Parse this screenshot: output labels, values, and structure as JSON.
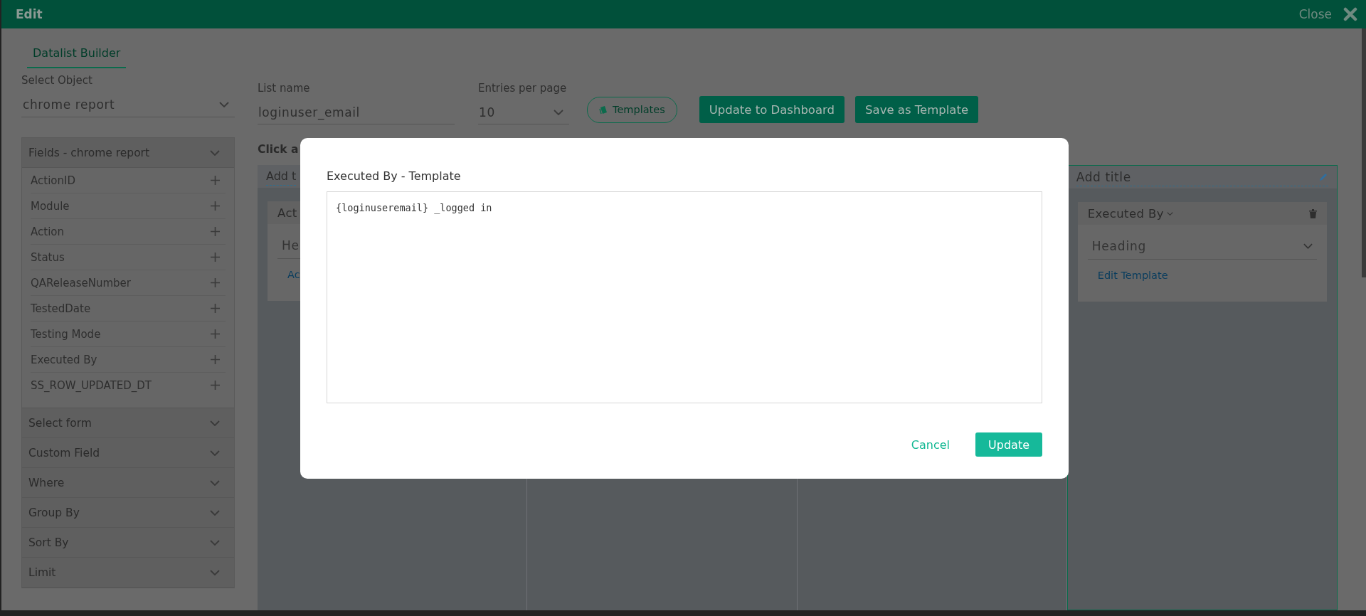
{
  "window": {
    "title": "Edit",
    "close_label": "Close"
  },
  "tabs": [
    {
      "label": "Datalist Builder",
      "selected": true
    }
  ],
  "select_object": {
    "label": "Select Object",
    "value": "chrome report"
  },
  "list_name": {
    "label": "List name",
    "value": "loginuser_email"
  },
  "entries_per_page": {
    "label": "Entries per page",
    "value": "10"
  },
  "toolbar_buttons": [
    {
      "label": "Templates",
      "kind": "outline"
    },
    {
      "label": "Update to Dashboard",
      "kind": "solid"
    },
    {
      "label": "Save as Template",
      "kind": "solid"
    }
  ],
  "sidebar": {
    "sections": [
      {
        "title": "Fields - chrome report",
        "items": [
          "ActionID",
          "Module",
          "Action",
          "Status",
          "QAReleaseNumber",
          "TestedDate",
          "Testing Mode",
          "Executed By",
          "SS_ROW_UPDATED_DT"
        ]
      },
      {
        "title": "Select form"
      },
      {
        "title": "Custom Field"
      },
      {
        "title": "Where"
      },
      {
        "title": "Group By"
      },
      {
        "title": "Sort By"
      },
      {
        "title": "Limit"
      }
    ]
  },
  "builder": {
    "instruction": "Click a",
    "columns": [
      {
        "title_placeholder": "Add t",
        "selected": false,
        "cards": [
          {
            "field": "Act",
            "display": "He",
            "link": "Ac"
          }
        ]
      },
      {
        "selected": false
      },
      {
        "selected": false
      },
      {
        "title_placeholder": "Add title",
        "selected": true,
        "cards": [
          {
            "field": "Executed By",
            "display": "Heading",
            "link": "Edit Template"
          }
        ]
      }
    ]
  },
  "modal": {
    "title": "Executed By - Template",
    "template_text": "{loginuseremail} _logged in",
    "buttons": [
      {
        "label": "Cancel",
        "kind": "link"
      },
      {
        "label": "Update",
        "kind": "primary"
      }
    ]
  }
}
